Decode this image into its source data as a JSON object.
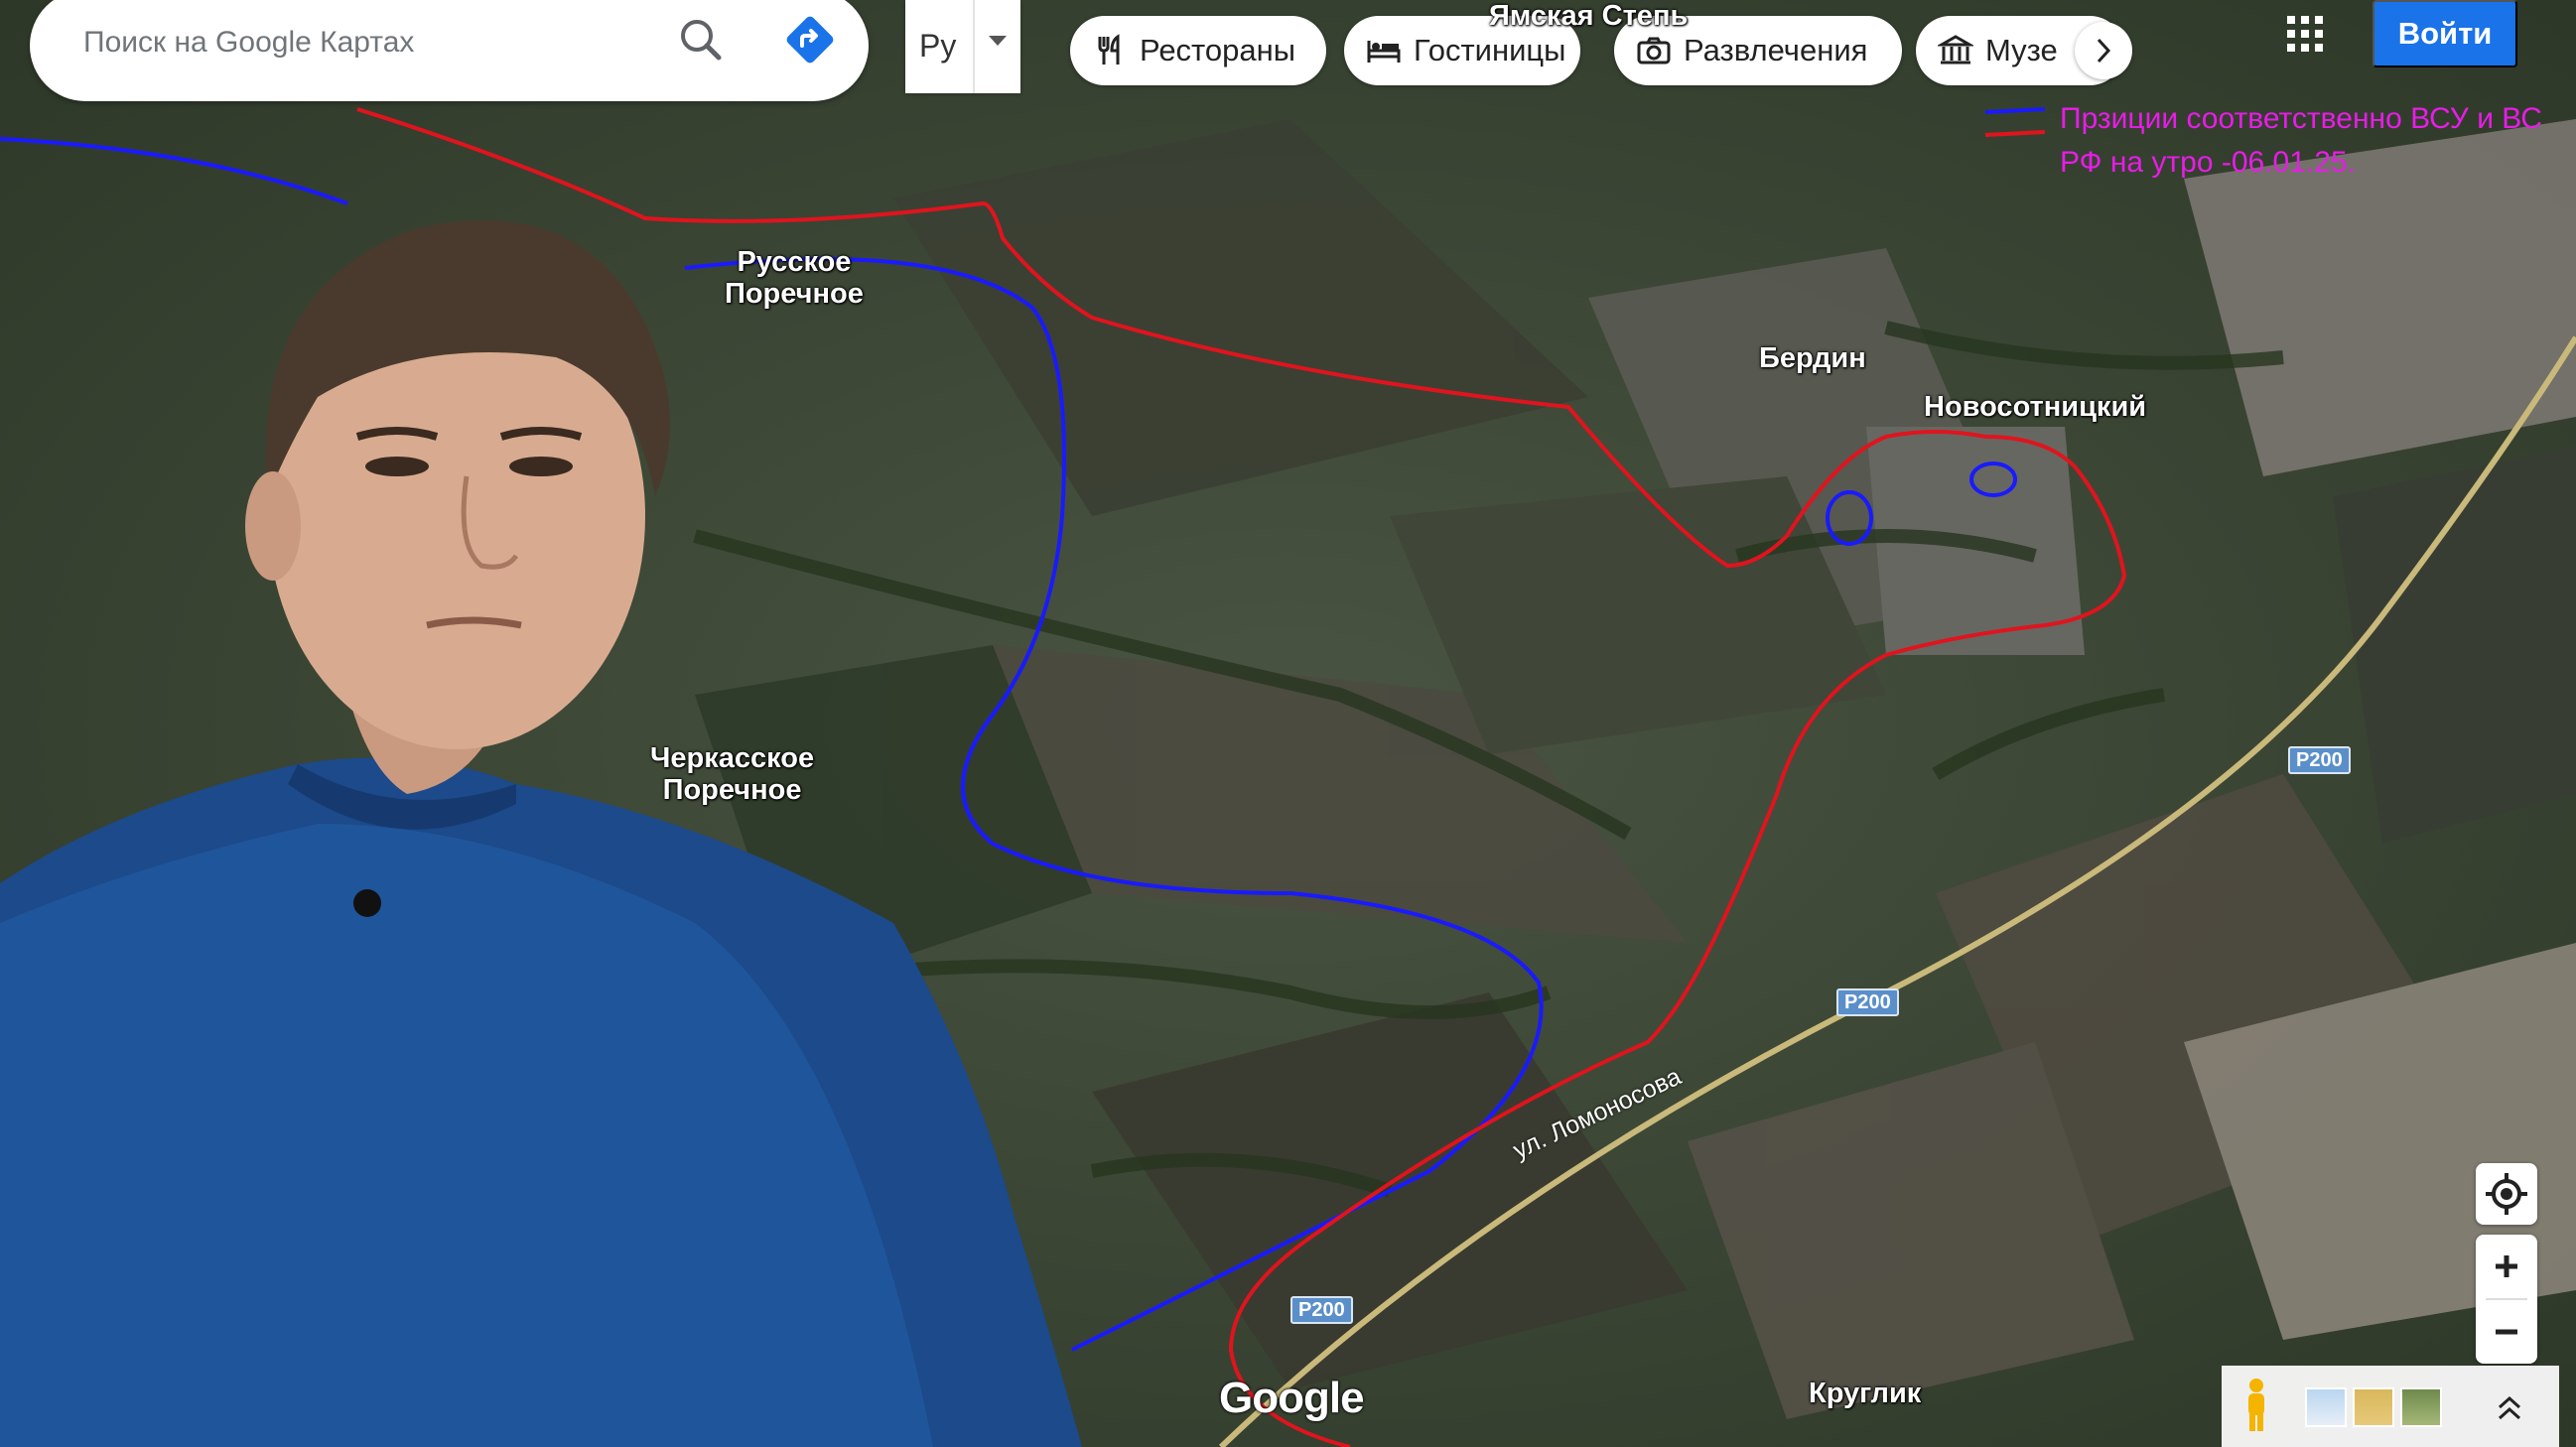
{
  "search": {
    "placeholder": "Поиск на Google Картах"
  },
  "language": {
    "label": "Ру"
  },
  "categories": [
    {
      "label": "Рестораны",
      "icon": "restaurant-icon"
    },
    {
      "label": "Гостиницы",
      "icon": "hotel-icon"
    },
    {
      "label": "Развлечения",
      "icon": "camera-icon"
    },
    {
      "label": "Музе",
      "icon": "museum-icon"
    }
  ],
  "header": {
    "signin_label": "Войти"
  },
  "legend": {
    "text": "Прзиции соответственно ВСУ и ВС РФ на утро -06.01.25.",
    "colors": {
      "ua": "#1a1aff",
      "ru": "#e0141e",
      "text": "#e81ce8"
    }
  },
  "places": {
    "yamskaya": "Ямская Степь",
    "russkoe_1": "Русское",
    "russkoe_2": "Поречное",
    "cherkasskoe_1": "Черкасское",
    "cherkasskoe_2": "Поречное",
    "berdin": "Бердин",
    "novosotnitsky": "Новосотницкий",
    "kruglik": "Круглик"
  },
  "roads": {
    "r200": "Р200",
    "street": "ул. Ломоносова"
  },
  "branding": {
    "google": "Google"
  }
}
